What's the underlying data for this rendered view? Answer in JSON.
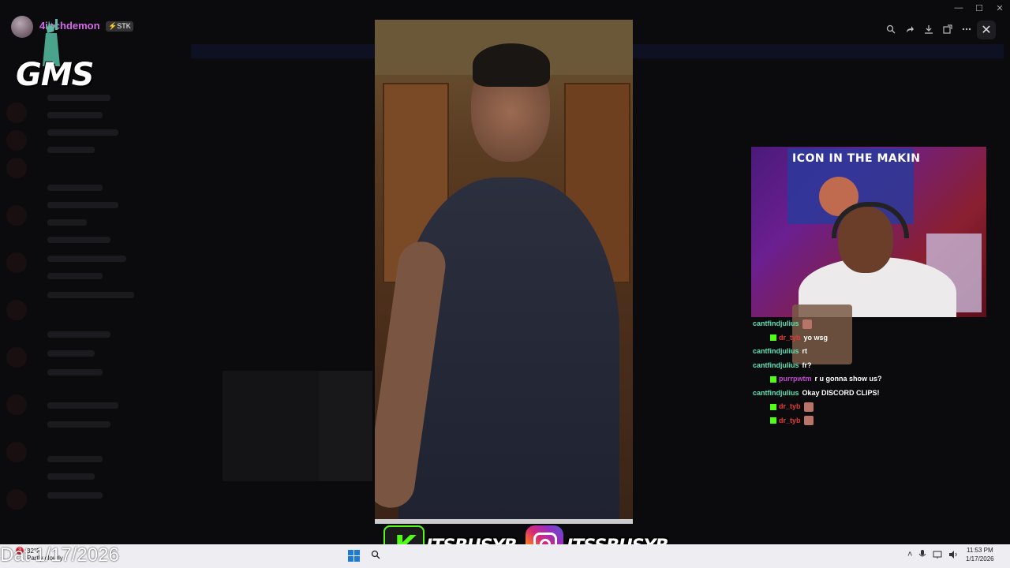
{
  "profile": {
    "username": "4inchdemon",
    "badge": "⚡STK",
    "overlay_logo": "GMS"
  },
  "viewer_toolbar": {
    "icons": [
      "zoom-icon",
      "forward-icon",
      "download-icon",
      "open-external-icon",
      "more-icon"
    ],
    "close_glyph": "✕"
  },
  "window_controls": {
    "minimize": "—",
    "maximize": "☐",
    "close": "✕"
  },
  "webcam": {
    "banner_text": "ICON IN THE MAKIN"
  },
  "chat": {
    "messages": [
      {
        "user": "cantfindjulius",
        "color": "#5ee0b5",
        "text": "",
        "emote": true,
        "badge": false
      },
      {
        "user": "dr_tyb",
        "color": "#e03a3a",
        "text": "yo wsg",
        "emote": false,
        "badge": true
      },
      {
        "user": "cantfindjulius",
        "color": "#5ee0b5",
        "text": "rt",
        "emote": false,
        "badge": false
      },
      {
        "user": "cantfindjulius",
        "color": "#5ee0b5",
        "text": "fr?",
        "emote": false,
        "badge": false
      },
      {
        "user": "purrpwtm",
        "color": "#c04ad0",
        "text": "r u gonna show us?",
        "emote": false,
        "badge": true
      },
      {
        "user": "cantfindjulius",
        "color": "#5ee0b5",
        "text": "Okay DISCORD CLIPS!",
        "emote": false,
        "badge": false
      },
      {
        "user": "dr_tyb",
        "color": "#e03a3a",
        "text": "",
        "emote": true,
        "badge": true
      },
      {
        "user": "dr_tyb",
        "color": "#e03a3a",
        "text": "",
        "emote": true,
        "badge": true
      }
    ]
  },
  "taskbar": {
    "weather_temp": "32°F",
    "weather_desc": "Partly cloudy",
    "weather_badge": "3",
    "date_overlay": "Dat 1/17/2026",
    "time": "11:53 PM",
    "date": "1/17/2026"
  },
  "socials": {
    "kick_handle": "ITSBUSYB",
    "instagram_handle": "ITSSBUSYB",
    "kick_letter": "K"
  },
  "colors": {
    "kick_green": "#53fc18",
    "username_pink": "#d46ae8"
  }
}
